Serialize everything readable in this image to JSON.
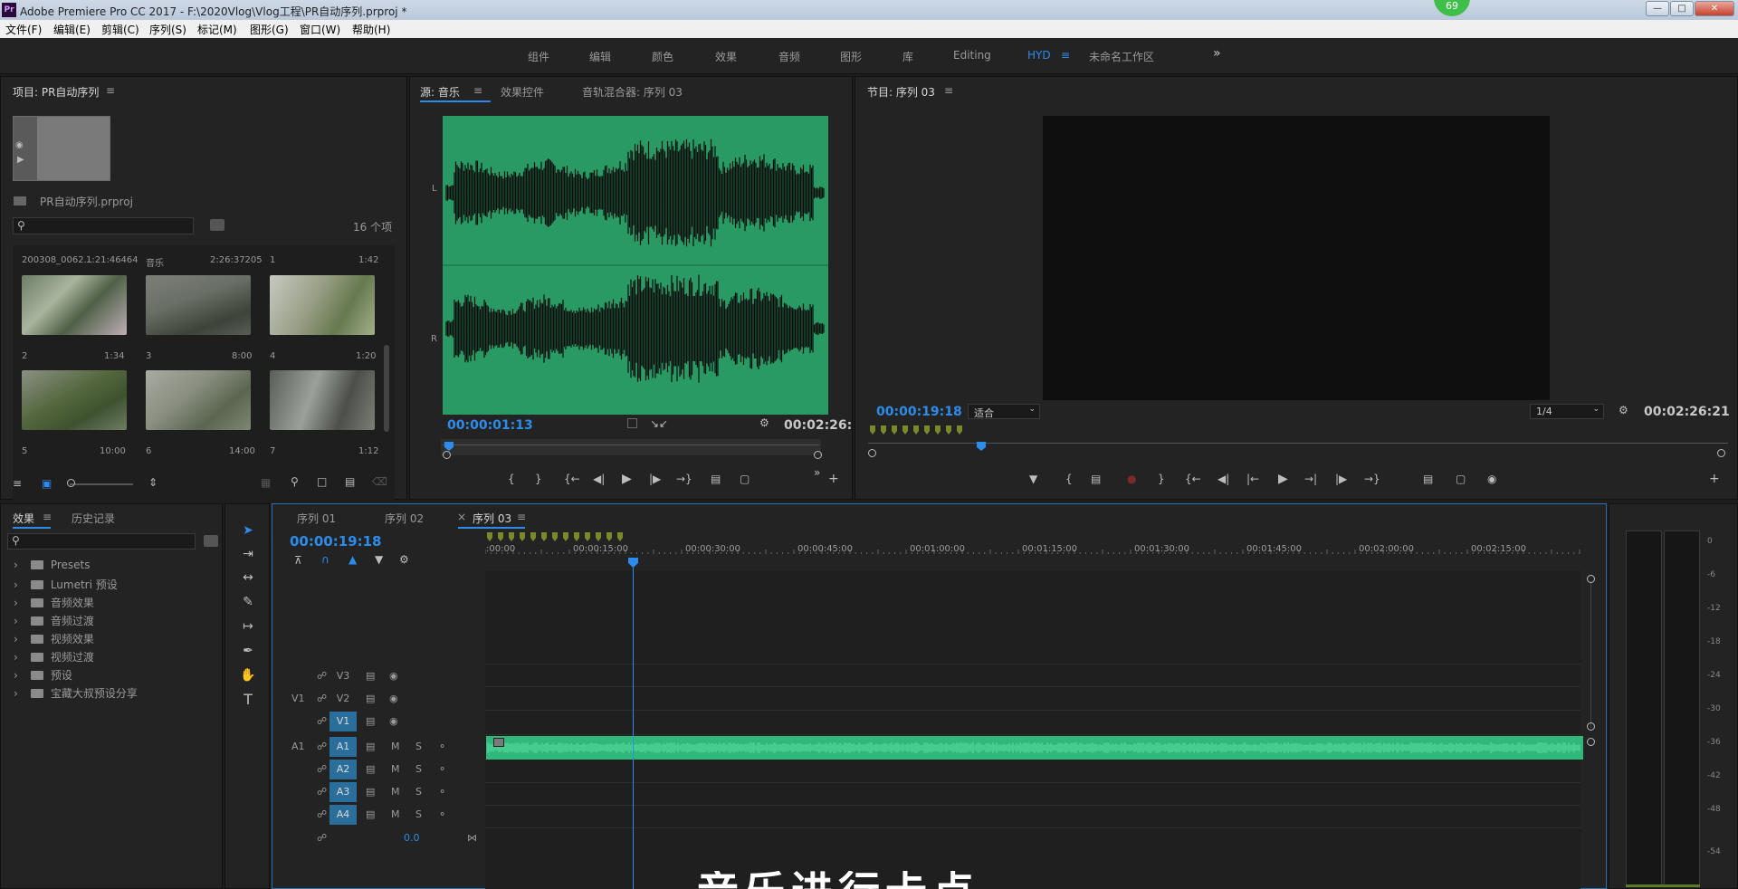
{
  "window": {
    "title": "Adobe Premiere Pro CC 2017 - F:\\2020Vlog\\Vlog工程\\PR自动序列.prproj *",
    "app_icon": "Pr",
    "badge": "69"
  },
  "menu": [
    "文件(F)",
    "编辑(E)",
    "剪辑(C)",
    "序列(S)",
    "标记(M)",
    "图形(G)",
    "窗口(W)",
    "帮助(H)"
  ],
  "workspaces": [
    "组件",
    "编辑",
    "颜色",
    "效果",
    "音频",
    "图形",
    "库",
    "Editing",
    "HYD",
    "未命名工作区"
  ],
  "workspace_active": "HYD",
  "project": {
    "title": "项目: PR自动序列",
    "filename": "PR自动序列.prproj",
    "item_count": "16 个项",
    "clips": [
      {
        "name": "200308_0062...",
        "dur": "1:21:46464"
      },
      {
        "name": "音乐",
        "dur": "2:26:37205"
      },
      {
        "name": "1",
        "dur": "1:42"
      },
      {
        "name": "2",
        "dur": "1:34"
      },
      {
        "name": "3",
        "dur": "8:00"
      },
      {
        "name": "4",
        "dur": "1:20"
      },
      {
        "name": "5",
        "dur": "10:00"
      },
      {
        "name": "6",
        "dur": "14:00"
      },
      {
        "name": "7",
        "dur": "1:12"
      }
    ]
  },
  "source": {
    "tabs": [
      "源: 音乐",
      "效果控件",
      "音轨混合器: 序列 03"
    ],
    "timecode": "00:00:01:13",
    "duration": "00:02:26:",
    "channel_l": "L",
    "channel_r": "R",
    "waveform_color": "#2a9a64"
  },
  "program": {
    "title": "节目: 序列 03",
    "timecode": "00:00:19:18",
    "fit": "适合",
    "resolution": "1/4",
    "duration": "00:02:26:21"
  },
  "effects": {
    "tabs": [
      "效果",
      "历史记录"
    ],
    "folders": [
      "Presets",
      "Lumetri 预设",
      "音频效果",
      "音频过渡",
      "视频效果",
      "视频过渡",
      "预设",
      "宝藏大叔预设分享"
    ]
  },
  "timeline": {
    "tabs": [
      "序列 01",
      "序列 02",
      "序列 03"
    ],
    "active_tab": "序列 03",
    "timecode": "00:00:19:18",
    "ruler": [
      ":00:00",
      "00:00:15:00",
      "00:00:30:00",
      "00:00:45:00",
      "00:01:00:00",
      "00:01:15:00",
      "00:01:30:00",
      "00:01:45:00",
      "00:02:00:00",
      "00:02:15:00"
    ],
    "video_tracks": [
      {
        "src": "",
        "name": "V3"
      },
      {
        "src": "V1",
        "name": "V2"
      },
      {
        "src": "",
        "name": "V1"
      }
    ],
    "audio_tracks": [
      {
        "src": "A1",
        "name": "A1"
      },
      {
        "src": "",
        "name": "A2"
      },
      {
        "src": "",
        "name": "A3"
      },
      {
        "src": "",
        "name": "A4"
      }
    ],
    "mute": "M",
    "solo": "S",
    "master_value": "0.0",
    "audio_clip_color": "#2fb87a"
  },
  "meter": {
    "labels": [
      "0",
      "-6",
      "-12",
      "-18",
      "-24",
      "-30",
      "-36",
      "-42",
      "-48",
      "-54"
    ]
  },
  "subtitle": "音乐进行卡点"
}
